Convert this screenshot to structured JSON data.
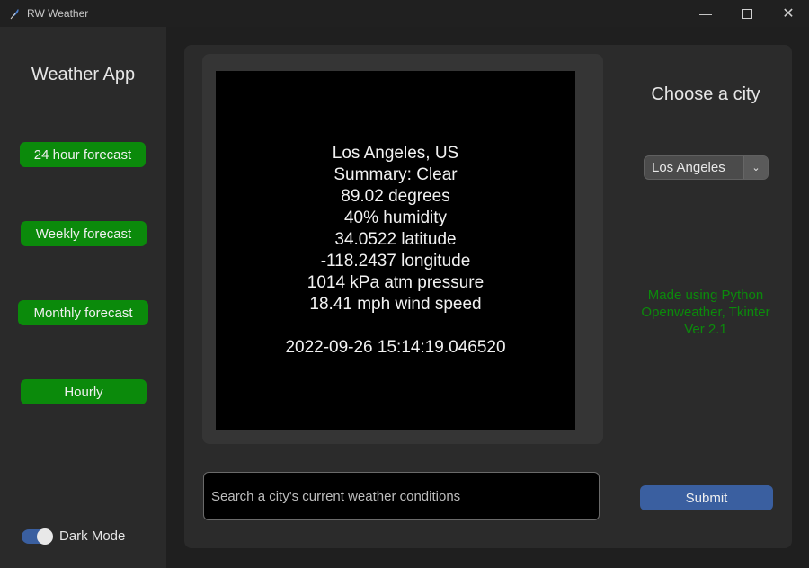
{
  "window": {
    "title": "RW Weather"
  },
  "sidebar": {
    "title": "Weather App",
    "buttons": [
      "24 hour forecast",
      "Weekly forecast",
      "Monthly forecast",
      "Hourly"
    ],
    "dark_mode_label": "Dark Mode",
    "dark_mode_on": true
  },
  "display": {
    "lines": [
      "Los Angeles,  US",
      "Summary: Clear",
      "89.02 degrees",
      "40% humidity",
      "34.0522 latitude",
      "-118.2437 longitude",
      "1014 kPa atm pressure",
      "18.41 mph wind speed"
    ],
    "timestamp": "2022-09-26 15:14:19.046520"
  },
  "search": {
    "placeholder": "Search a city's current weather conditions"
  },
  "city": {
    "title": "Choose a city",
    "selected": "Los Angeles"
  },
  "credits": {
    "line1": "Made using Python",
    "line2": "Openweather, Tkinter",
    "line3": "Ver 2.1"
  },
  "submit_label": "Submit",
  "colors": {
    "accent_green": "#0b8a0b",
    "accent_blue": "#3a5fa0",
    "background": "#1f1f1f"
  }
}
